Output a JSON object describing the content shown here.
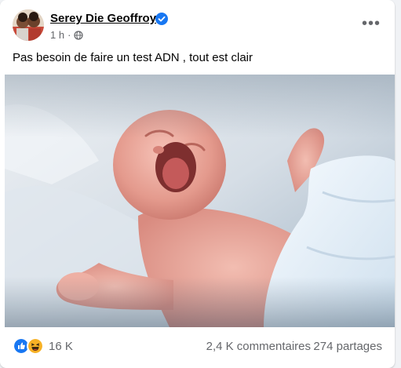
{
  "post": {
    "author_name": "Serey Die Geoffroy",
    "time": "1 h",
    "meta_separator": "·",
    "audience_icon": "globe-icon",
    "more_label": "•••",
    "text": "Pas besoin de faire un test ADN , tout est clair"
  },
  "reactions": {
    "icons": [
      "like-icon",
      "haha-icon"
    ],
    "count": "16 K",
    "comments": "2,4 K commentaires",
    "shares": "274 partages"
  },
  "colors": {
    "brand_blue": "#1877f2",
    "haha_yellow": "#f7b125",
    "secondary_text": "#65676b",
    "primary_text": "#050505"
  }
}
